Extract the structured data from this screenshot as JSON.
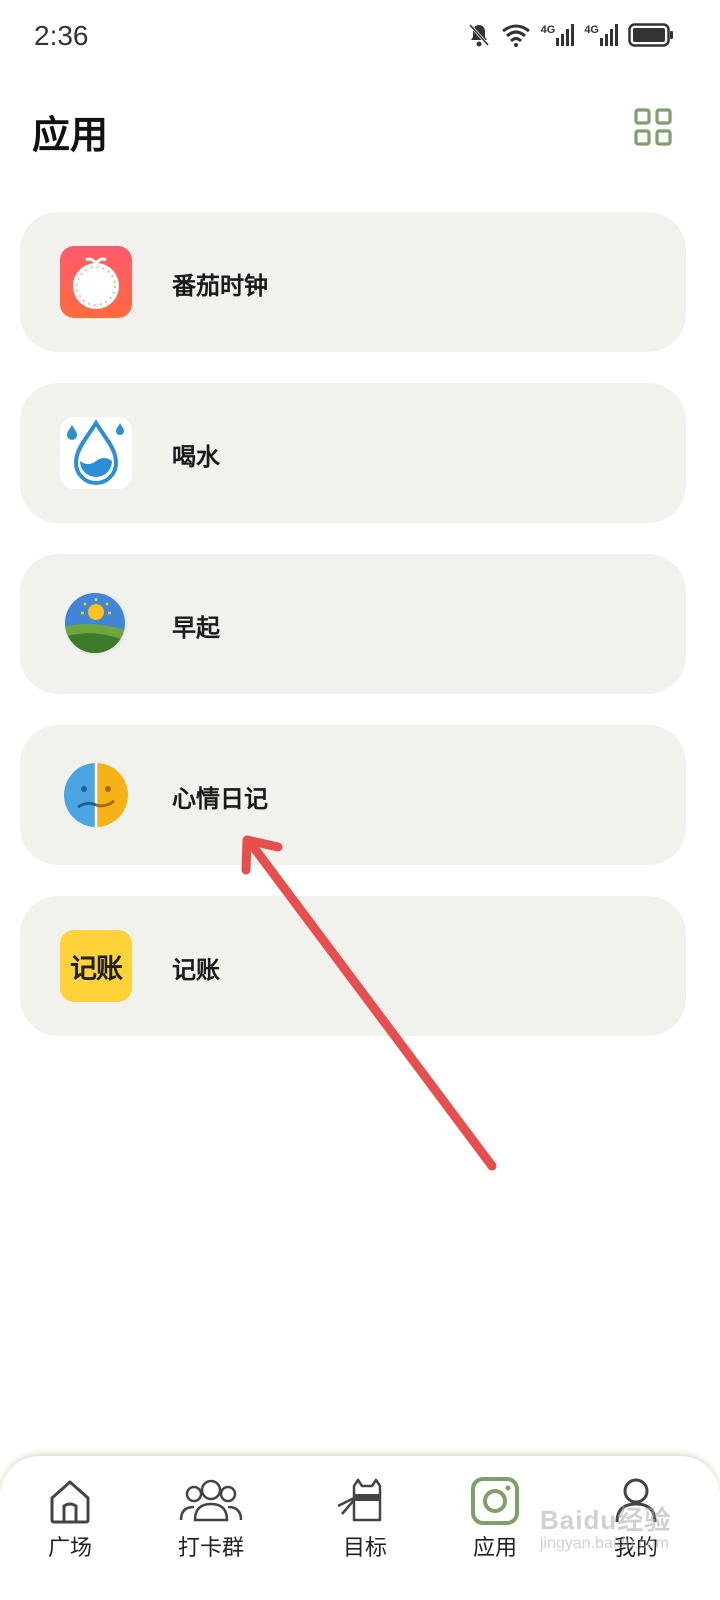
{
  "status_bar": {
    "time": "2:36",
    "network_1": "4G",
    "network_2": "4G"
  },
  "header": {
    "title": "应用",
    "grid_icon": "grid-icon"
  },
  "apps": [
    {
      "label": "番茄时钟",
      "icon": "tomato-clock-icon"
    },
    {
      "label": "喝水",
      "icon": "water-drop-icon"
    },
    {
      "label": "早起",
      "icon": "sunrise-icon"
    },
    {
      "label": "心情日记",
      "icon": "mood-face-icon"
    },
    {
      "label": "记账",
      "icon": "bookkeeping-icon",
      "icon_text": "记账"
    }
  ],
  "bottom_nav": [
    {
      "label": "广场",
      "icon": "home-icon"
    },
    {
      "label": "打卡群",
      "icon": "group-icon"
    },
    {
      "label": "目标",
      "icon": "target-icon"
    },
    {
      "label": "应用",
      "icon": "apps-icon",
      "active": true
    },
    {
      "label": "我的",
      "icon": "profile-icon"
    }
  ],
  "watermark": {
    "text": "Baidu经验",
    "sub": "jingyan.baidu.com"
  },
  "colors": {
    "accent": "#7ea06a",
    "card_bg": "#f1f2ee",
    "arrow": "#e84e4e"
  }
}
